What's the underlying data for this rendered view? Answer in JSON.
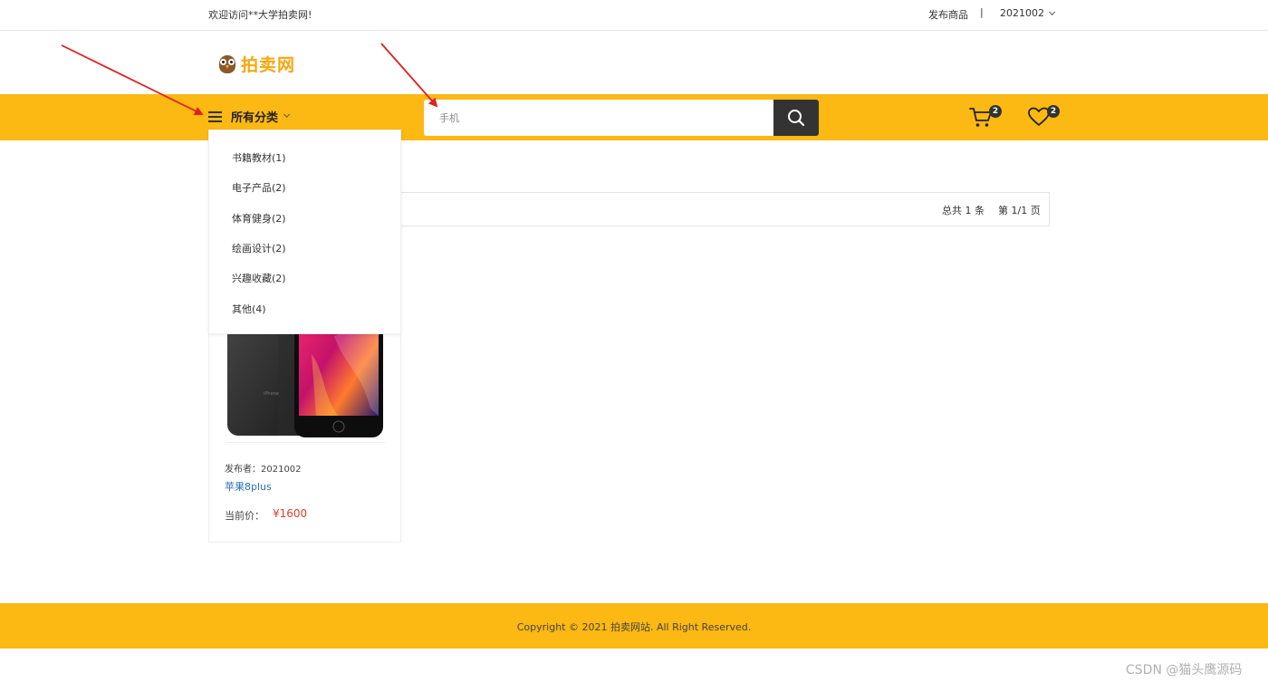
{
  "topbar": {
    "welcome": "欢迎访问**大学拍卖网!",
    "publish": "发布商品",
    "separator": "|",
    "user": "2021002"
  },
  "logo": {
    "text": "拍卖网",
    "icon": "owl-icon"
  },
  "nav": {
    "category_label": "所有分类",
    "search_placeholder": "手机",
    "cart_count": "2",
    "wishlist_count": "2"
  },
  "categories": [
    {
      "label": "书籍教材(1)"
    },
    {
      "label": "电子产品(2)"
    },
    {
      "label": "体育健身(2)"
    },
    {
      "label": "绘画设计(2)"
    },
    {
      "label": "兴趣收藏(2)"
    },
    {
      "label": "其他(4)"
    }
  ],
  "results": {
    "total": "总共 1 条",
    "pages": "第 1/1 页"
  },
  "product": {
    "seller": "发布者：2021002",
    "name": "苹果8plus",
    "price_label": "当前价：",
    "price": "¥1600"
  },
  "footer": {
    "copyright": "Copyright © 2021 拍卖网站. All Right Reserved."
  },
  "watermark": "CSDN @猫头鹰源码",
  "colors": {
    "brand_yellow": "#fcb813",
    "logo_orange": "#f7a70f",
    "price_red": "#e43b2c",
    "link_blue": "#2a6ebb",
    "annotation_red": "#e02020"
  }
}
